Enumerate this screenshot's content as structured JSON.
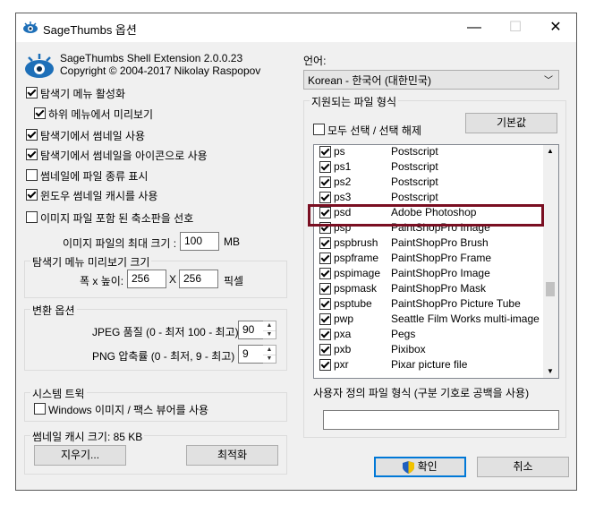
{
  "window": {
    "title": "SageThumbs 옵션",
    "minimize_glyph": "—",
    "maximize_glyph": "☐",
    "close_glyph": "✕"
  },
  "app": {
    "name_version": "SageThumbs Shell Extension 2.0.0.23",
    "copyright": "Copyright © 2004-2017 Nikolay Raspopov"
  },
  "options": {
    "enable_menu": "탐색기 메뉴 활성화",
    "submenu_preview": "하위 메뉴에서 미리보기",
    "use_thumbnails": "탐색기에서 썸네일 사용",
    "thumbs_as_icons": "탐색기에서 썸네일을 아이콘으로 사용",
    "show_file_type": "썸네일에 파일 종류 표시",
    "use_windows_cache": "윈도우 썸네일 캐시를 사용",
    "prefer_embedded": "이미지 파일 포함 된 축소판을 선호",
    "max_size_label": "이미지 파일의 최대 크기 :",
    "max_size_value": "100",
    "max_size_unit": "MB"
  },
  "preview_group": {
    "title": "탐색기 메뉴 미리보기 크기",
    "wh_label": "폭 x 높이:",
    "width": "256",
    "x": "X",
    "height": "256",
    "unit": "픽셀"
  },
  "convert_group": {
    "title": "변환 옵션",
    "jpeg_label": "JPEG 품질 (0 - 최저 100 - 최고)",
    "jpeg_value": "90",
    "png_label": "PNG 압축률 (0 - 최저, 9 - 최고)",
    "png_value": "9"
  },
  "tray_group": {
    "title": "시스템 트윅",
    "windows_viewer": "Windows 이미지 / 팩스 뷰어를 사용"
  },
  "cache_group": {
    "title": "썸네일 캐시 크기: 85 KB",
    "clear_button": "지우기...",
    "optimize_button": "최적화"
  },
  "language": {
    "label": "언어:",
    "selected": "Korean - 한국어 (대한민국)"
  },
  "formats": {
    "title": "지원되는 파일 형식",
    "select_all": "모두 선택 / 선택 해제",
    "default_button": "기본값",
    "rows": [
      {
        "ext": "ps",
        "desc": "Postscript"
      },
      {
        "ext": "ps1",
        "desc": "Postscript"
      },
      {
        "ext": "ps2",
        "desc": "Postscript"
      },
      {
        "ext": "ps3",
        "desc": "Postscript"
      },
      {
        "ext": "psd",
        "desc": "Adobe Photoshop"
      },
      {
        "ext": "psp",
        "desc": "PaintShopPro Image"
      },
      {
        "ext": "pspbrush",
        "desc": "PaintShopPro Brush"
      },
      {
        "ext": "pspframe",
        "desc": "PaintShopPro Frame"
      },
      {
        "ext": "pspimage",
        "desc": "PaintShopPro Image"
      },
      {
        "ext": "pspmask",
        "desc": "PaintShopPro Mask"
      },
      {
        "ext": "psptube",
        "desc": "PaintShopPro Picture Tube"
      },
      {
        "ext": "pwp",
        "desc": "Seattle Film Works multi-image"
      },
      {
        "ext": "pxa",
        "desc": "Pegs"
      },
      {
        "ext": "pxb",
        "desc": "Pixibox"
      },
      {
        "ext": "pxr",
        "desc": "Pixar picture file"
      }
    ]
  },
  "custom": {
    "label": "사용자 정의 파일 형식 (구분 기호로 공백을 사용)",
    "value": ""
  },
  "footer": {
    "ok": "확인",
    "cancel": "취소"
  },
  "colors": {
    "highlight": "#7a0f22",
    "logo": "#1d6fb8"
  }
}
